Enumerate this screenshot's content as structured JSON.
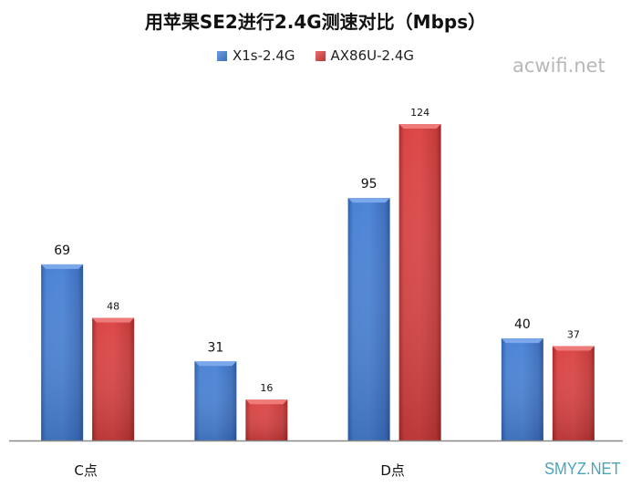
{
  "chart_data": {
    "type": "bar",
    "title": "用苹果SE2进行2.4G测速对比（Mbps）",
    "xlabel": "",
    "ylabel": "",
    "ylim": [
      0,
      124
    ],
    "grid": false,
    "legend_position": "top-center",
    "categories": [
      "C点",
      "",
      "D点",
      ""
    ],
    "series": [
      {
        "name": "X1s-2.4G",
        "color": "#4a7fcf",
        "values": [
          69,
          31,
          95,
          40
        ]
      },
      {
        "name": "AX86U-2.4G",
        "color": "#d94545",
        "values": [
          48,
          16,
          124,
          37
        ]
      }
    ]
  },
  "watermarks": {
    "top_right": "acwifi.net",
    "bottom_right": "SMYZ.NET"
  }
}
